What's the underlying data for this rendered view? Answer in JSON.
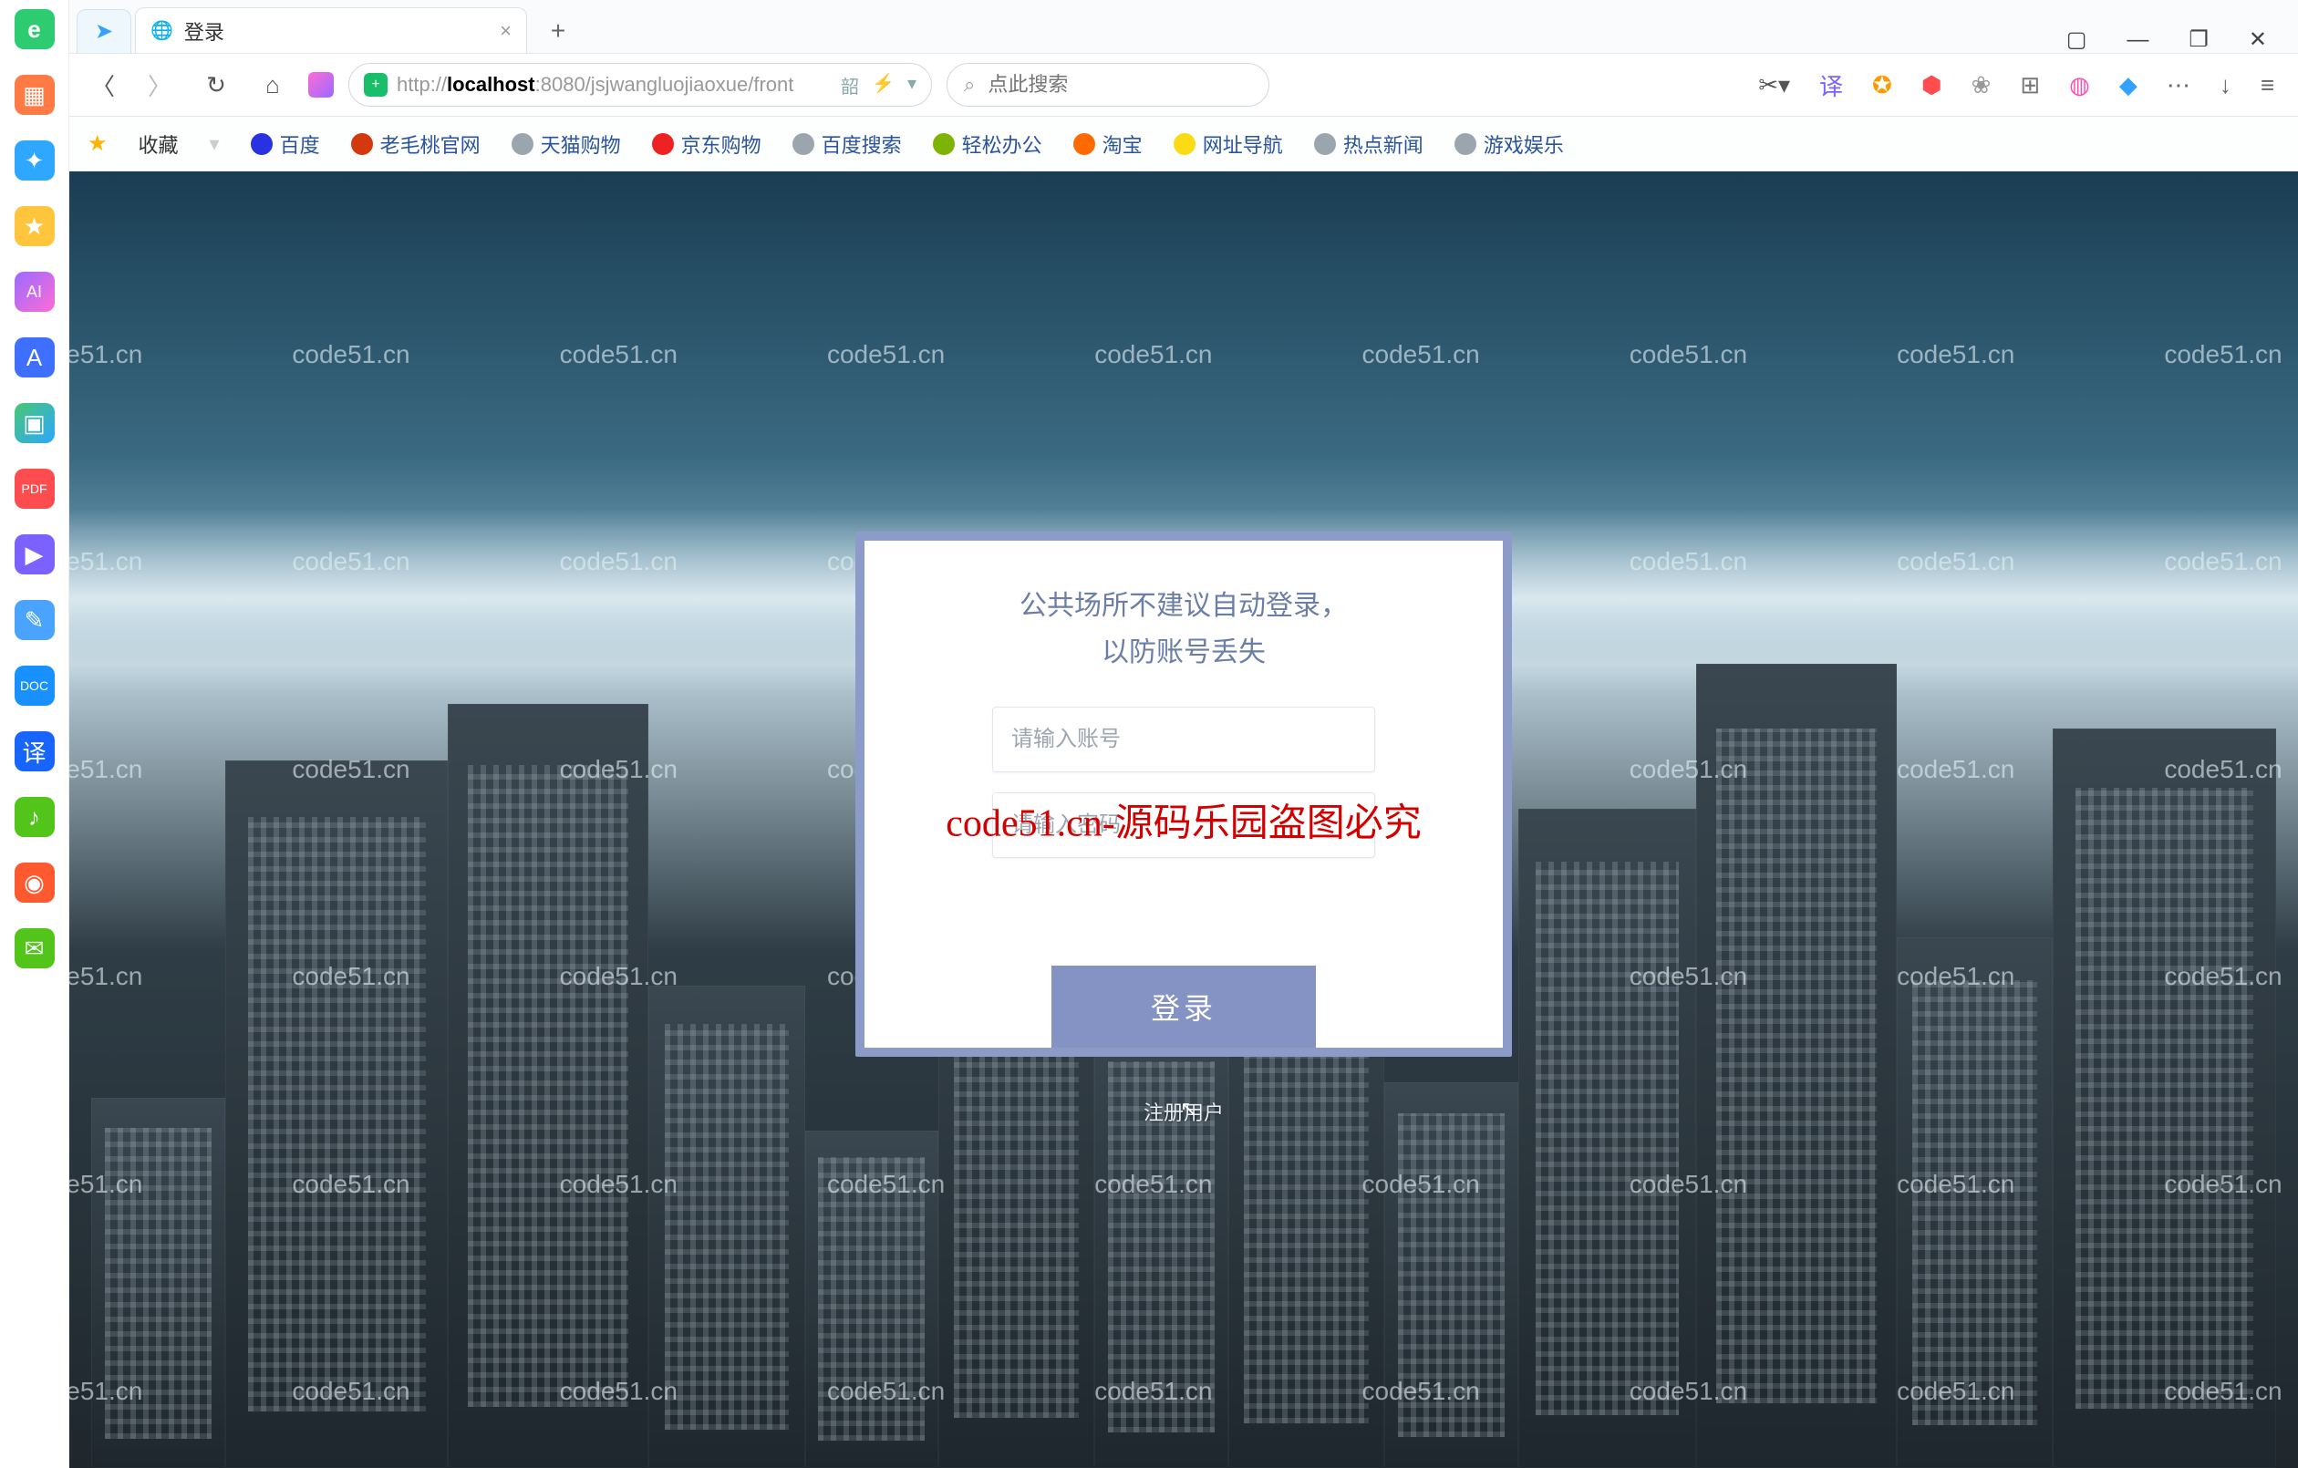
{
  "sidebar": {
    "items": [
      {
        "name": "browser-logo",
        "glyph": "e"
      },
      {
        "name": "app-orange",
        "glyph": "▦"
      },
      {
        "name": "app-assist",
        "glyph": "✦"
      },
      {
        "name": "app-star",
        "glyph": "★"
      },
      {
        "name": "app-ai",
        "glyph": "AI"
      },
      {
        "name": "app-af",
        "glyph": "A"
      },
      {
        "name": "app-pic",
        "glyph": "▣"
      },
      {
        "name": "app-pdf",
        "glyph": "PDF"
      },
      {
        "name": "app-video",
        "glyph": "▶"
      },
      {
        "name": "app-note",
        "glyph": "✎"
      },
      {
        "name": "app-doc",
        "glyph": "DOC"
      },
      {
        "name": "app-translate",
        "glyph": "译"
      },
      {
        "name": "app-game",
        "glyph": "♪"
      },
      {
        "name": "app-weibo",
        "glyph": "◉"
      },
      {
        "name": "app-mail",
        "glyph": "✉"
      }
    ],
    "plus": "+",
    "menu": "≡"
  },
  "tabs": {
    "pinned_icon": "➤",
    "active": {
      "title": "登录",
      "close": "×"
    },
    "new_tab": "+"
  },
  "window": {
    "layout": "▢",
    "min": "—",
    "max": "❐",
    "close": "✕"
  },
  "nav": {
    "back": "〈",
    "forward": "〉",
    "reload": "↻",
    "home": "⌂"
  },
  "address": {
    "scheme": "http://",
    "host": "localhost",
    "rest": ":8080/jsjwangluojiaoxue/front",
    "tail_icons": [
      "韶",
      "⚡",
      "▾"
    ]
  },
  "search": {
    "icon": "⌕",
    "placeholder": "点此搜索"
  },
  "toolbar_icons": [
    "✂▾",
    "译",
    "✪",
    "⬢",
    "❀",
    "⊞",
    "◍",
    "◆",
    "⋯",
    "↓",
    "≡"
  ],
  "bookmarks": {
    "fav_label": "收藏",
    "items": [
      {
        "label": "百度",
        "cls": "bi-baidu"
      },
      {
        "label": "老毛桃官网",
        "cls": "bi-red"
      },
      {
        "label": "天猫购物",
        "cls": "bi-globe"
      },
      {
        "label": "京东购物",
        "cls": "bi-jd"
      },
      {
        "label": "百度搜索",
        "cls": "bi-globe"
      },
      {
        "label": "轻松办公",
        "cls": "bi-green"
      },
      {
        "label": "淘宝",
        "cls": "bi-tb"
      },
      {
        "label": "网址导航",
        "cls": "bi-yellow"
      },
      {
        "label": "热点新闻",
        "cls": "bi-globe"
      },
      {
        "label": "游戏娱乐",
        "cls": "bi-globe"
      }
    ]
  },
  "login": {
    "tip_line1": "公共场所不建议自动登录，",
    "tip_line2": "以防账号丢失",
    "username_placeholder": "请输入账号",
    "password_placeholder": "请输入密码",
    "submit": "登录",
    "register": "注册用户"
  },
  "watermark": {
    "text": "code51.cn",
    "center": "code51.cn-源码乐园盗图必究"
  }
}
